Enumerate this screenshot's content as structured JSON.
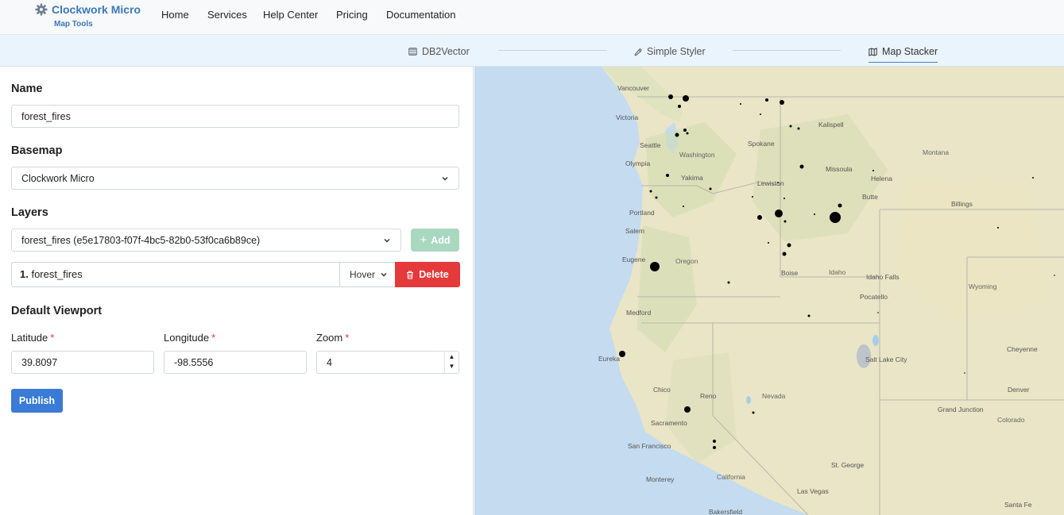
{
  "header": {
    "brand_title": "Clockwork Micro",
    "brand_subtitle": "Map Tools",
    "nav": [
      "Home",
      "Services",
      "Help Center",
      "Pricing",
      "Documentation"
    ]
  },
  "subnav": {
    "tabs": [
      {
        "label": "DB2Vector",
        "icon": "database-icon"
      },
      {
        "label": "Simple Styler",
        "icon": "brush-icon"
      },
      {
        "label": "Map Stacker",
        "icon": "map-icon",
        "active": true
      }
    ]
  },
  "form": {
    "name_title": "Name",
    "name_value": "forest_fires",
    "basemap_title": "Basemap",
    "basemap_value": "Clockwork Micro",
    "layers_title": "Layers",
    "layer_select_value": "forest_fires (e5e17803-f07f-4bc5-82b0-53f0ca6b89ce)",
    "add_label": "Add",
    "layer_items": [
      {
        "index": "1.",
        "name": "forest_fires",
        "mode": "Hover",
        "delete_label": "Delete"
      }
    ],
    "viewport_title": "Default Viewport",
    "latitude_label": "Latitude",
    "latitude_value": "39.8097",
    "longitude_label": "Longitude",
    "longitude_value": "-98.5556",
    "zoom_label": "Zoom",
    "zoom_value": "4",
    "required_mark": "*",
    "publish_label": "Publish"
  },
  "map": {
    "places": [
      "Vancouver",
      "Victoria",
      "Seattle",
      "Washington",
      "Olympia",
      "Yakima",
      "Spokane",
      "Kalispell",
      "Montana",
      "Missoula",
      "Helena",
      "Lewiston",
      "Butte",
      "Billings",
      "Portland",
      "Salem",
      "Eugene",
      "Oregon",
      "Boise",
      "Idaho",
      "Idaho Falls",
      "Pocatello",
      "Wyoming",
      "Medford",
      "Eureka",
      "Chico",
      "Reno",
      "Nevada",
      "Sacramento",
      "San Francisco",
      "Salt Lake City",
      "Cheyenne",
      "Denver",
      "Grand Junction",
      "Colorado",
      "St. George",
      "California",
      "Monterey",
      "Las Vegas",
      "Santa Fe",
      "Bakersfield"
    ],
    "colors": {
      "ocean": "#c4dbf0",
      "land": "#e9e5c6",
      "water": "#a9cde8",
      "fire": "#000000"
    }
  }
}
